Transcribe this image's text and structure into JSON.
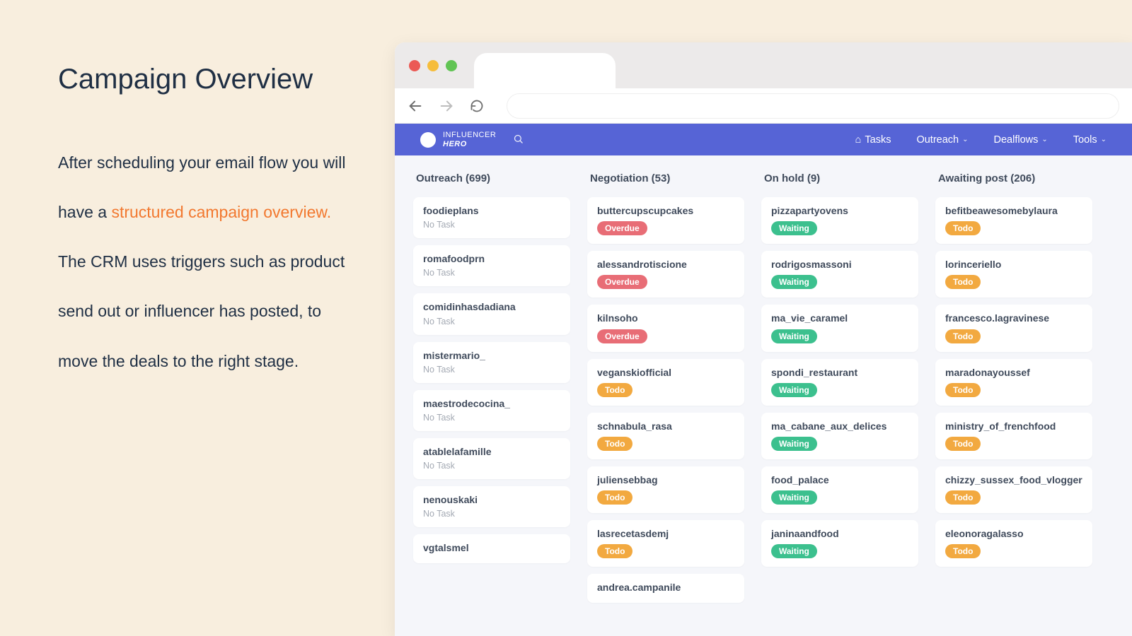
{
  "left": {
    "title": "Campaign Overview",
    "p1": "After scheduling your email flow you will have a ",
    "hl": "structured campaign overview.",
    "p2": " The CRM uses triggers such as product send out or influencer has posted,  to move the deals to the right stage."
  },
  "logo": {
    "line1": "INFLUENCER",
    "line2": "HERO"
  },
  "nav": {
    "tasks": "Tasks",
    "outreach": "Outreach",
    "dealflows": "Dealflows",
    "tools": "Tools"
  },
  "columns": [
    {
      "title": "Outreach (699)",
      "cards": [
        {
          "name": "foodieplans",
          "sub": "No Task",
          "badge": null
        },
        {
          "name": "romafoodprn",
          "sub": "No Task",
          "badge": null
        },
        {
          "name": "comidinhasdadiana",
          "sub": "No Task",
          "badge": null
        },
        {
          "name": "mistermario_",
          "sub": "No Task",
          "badge": null
        },
        {
          "name": "maestrodecocina_",
          "sub": "No Task",
          "badge": null
        },
        {
          "name": "atablelafamille",
          "sub": "No Task",
          "badge": null
        },
        {
          "name": "nenouskaki",
          "sub": "No Task",
          "badge": null
        },
        {
          "name": "vgtalsmel",
          "sub": null,
          "badge": null
        }
      ]
    },
    {
      "title": "Negotiation (53)",
      "cards": [
        {
          "name": "buttercupscupcakes",
          "sub": null,
          "badge": "Overdue"
        },
        {
          "name": "alessandrotiscione",
          "sub": null,
          "badge": "Overdue"
        },
        {
          "name": "kilnsoho",
          "sub": null,
          "badge": "Overdue"
        },
        {
          "name": "veganskiofficial",
          "sub": null,
          "badge": "Todo"
        },
        {
          "name": "schnabula_rasa",
          "sub": null,
          "badge": "Todo"
        },
        {
          "name": "juliensebbag",
          "sub": null,
          "badge": "Todo"
        },
        {
          "name": "lasrecetasdemj",
          "sub": null,
          "badge": "Todo"
        },
        {
          "name": "andrea.campanile",
          "sub": null,
          "badge": null
        }
      ]
    },
    {
      "title": "On hold (9)",
      "cards": [
        {
          "name": "pizzapartyovens",
          "sub": null,
          "badge": "Waiting"
        },
        {
          "name": "rodrigosmassoni",
          "sub": null,
          "badge": "Waiting"
        },
        {
          "name": "ma_vie_caramel",
          "sub": null,
          "badge": "Waiting"
        },
        {
          "name": "spondi_restaurant",
          "sub": null,
          "badge": "Waiting"
        },
        {
          "name": "ma_cabane_aux_delices",
          "sub": null,
          "badge": "Waiting"
        },
        {
          "name": "food_palace",
          "sub": null,
          "badge": "Waiting"
        },
        {
          "name": "janinaandfood",
          "sub": null,
          "badge": "Waiting"
        }
      ]
    },
    {
      "title": "Awaiting post (206)",
      "cards": [
        {
          "name": "befitbeawesomebylaura",
          "sub": null,
          "badge": "Todo"
        },
        {
          "name": "lorinceriello",
          "sub": null,
          "badge": "Todo"
        },
        {
          "name": "francesco.lagravinese",
          "sub": null,
          "badge": "Todo"
        },
        {
          "name": "maradonayoussef",
          "sub": null,
          "badge": "Todo"
        },
        {
          "name": "ministry_of_frenchfood",
          "sub": null,
          "badge": "Todo"
        },
        {
          "name": "chizzy_sussex_food_vlogger",
          "sub": null,
          "badge": "Todo"
        },
        {
          "name": "eleonoragalasso",
          "sub": null,
          "badge": "Todo"
        }
      ]
    }
  ]
}
